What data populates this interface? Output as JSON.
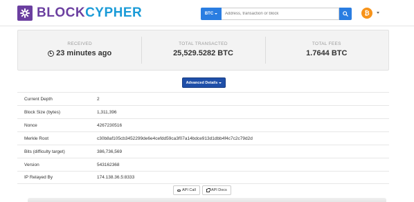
{
  "header": {
    "brand_part1": "BLOCK",
    "brand_part2": "CYPHER",
    "coin_select_label": "BTC",
    "search_placeholder": "Address, transaction or block",
    "currency_icon": "bitcoin-icon",
    "currency_symbol": "₿"
  },
  "stats": [
    {
      "label": "RECEIVED",
      "value": "23 minutes ago",
      "icon": "clock-icon"
    },
    {
      "label": "TOTAL TRANSACTED",
      "value": "25,529.5282 BTC"
    },
    {
      "label": "TOTAL FEES",
      "value": "1.7644 BTC"
    }
  ],
  "advanced_button_label": "Advanced Details",
  "details": [
    {
      "label": "Current Depth",
      "value": "2"
    },
    {
      "label": "Block Size (bytes)",
      "value": "1,311,396"
    },
    {
      "label": "Nonce",
      "value": "4267230516"
    },
    {
      "label": "Merkle Root",
      "value": "c30b8af105cb3452299de6e4cefdd59ca3f07a14bdce913d1dbb4f4c7c2c79d2d"
    },
    {
      "label": "Bits (difficulty target)",
      "value": "386,736,569"
    },
    {
      "label": "Version",
      "value": "543162368"
    },
    {
      "label": "IP Relayed By",
      "value": "174.138.36.5:8333"
    }
  ],
  "api_buttons": {
    "api_call": "API Call",
    "api_docs": "API Docs"
  },
  "colors": {
    "brand_purple": "#6b3fa0",
    "brand_blue": "#1a9bd7",
    "primary_button": "#2a7de1",
    "advanced_button": "#1f4fa8",
    "bitcoin_orange": "#f7931a"
  }
}
